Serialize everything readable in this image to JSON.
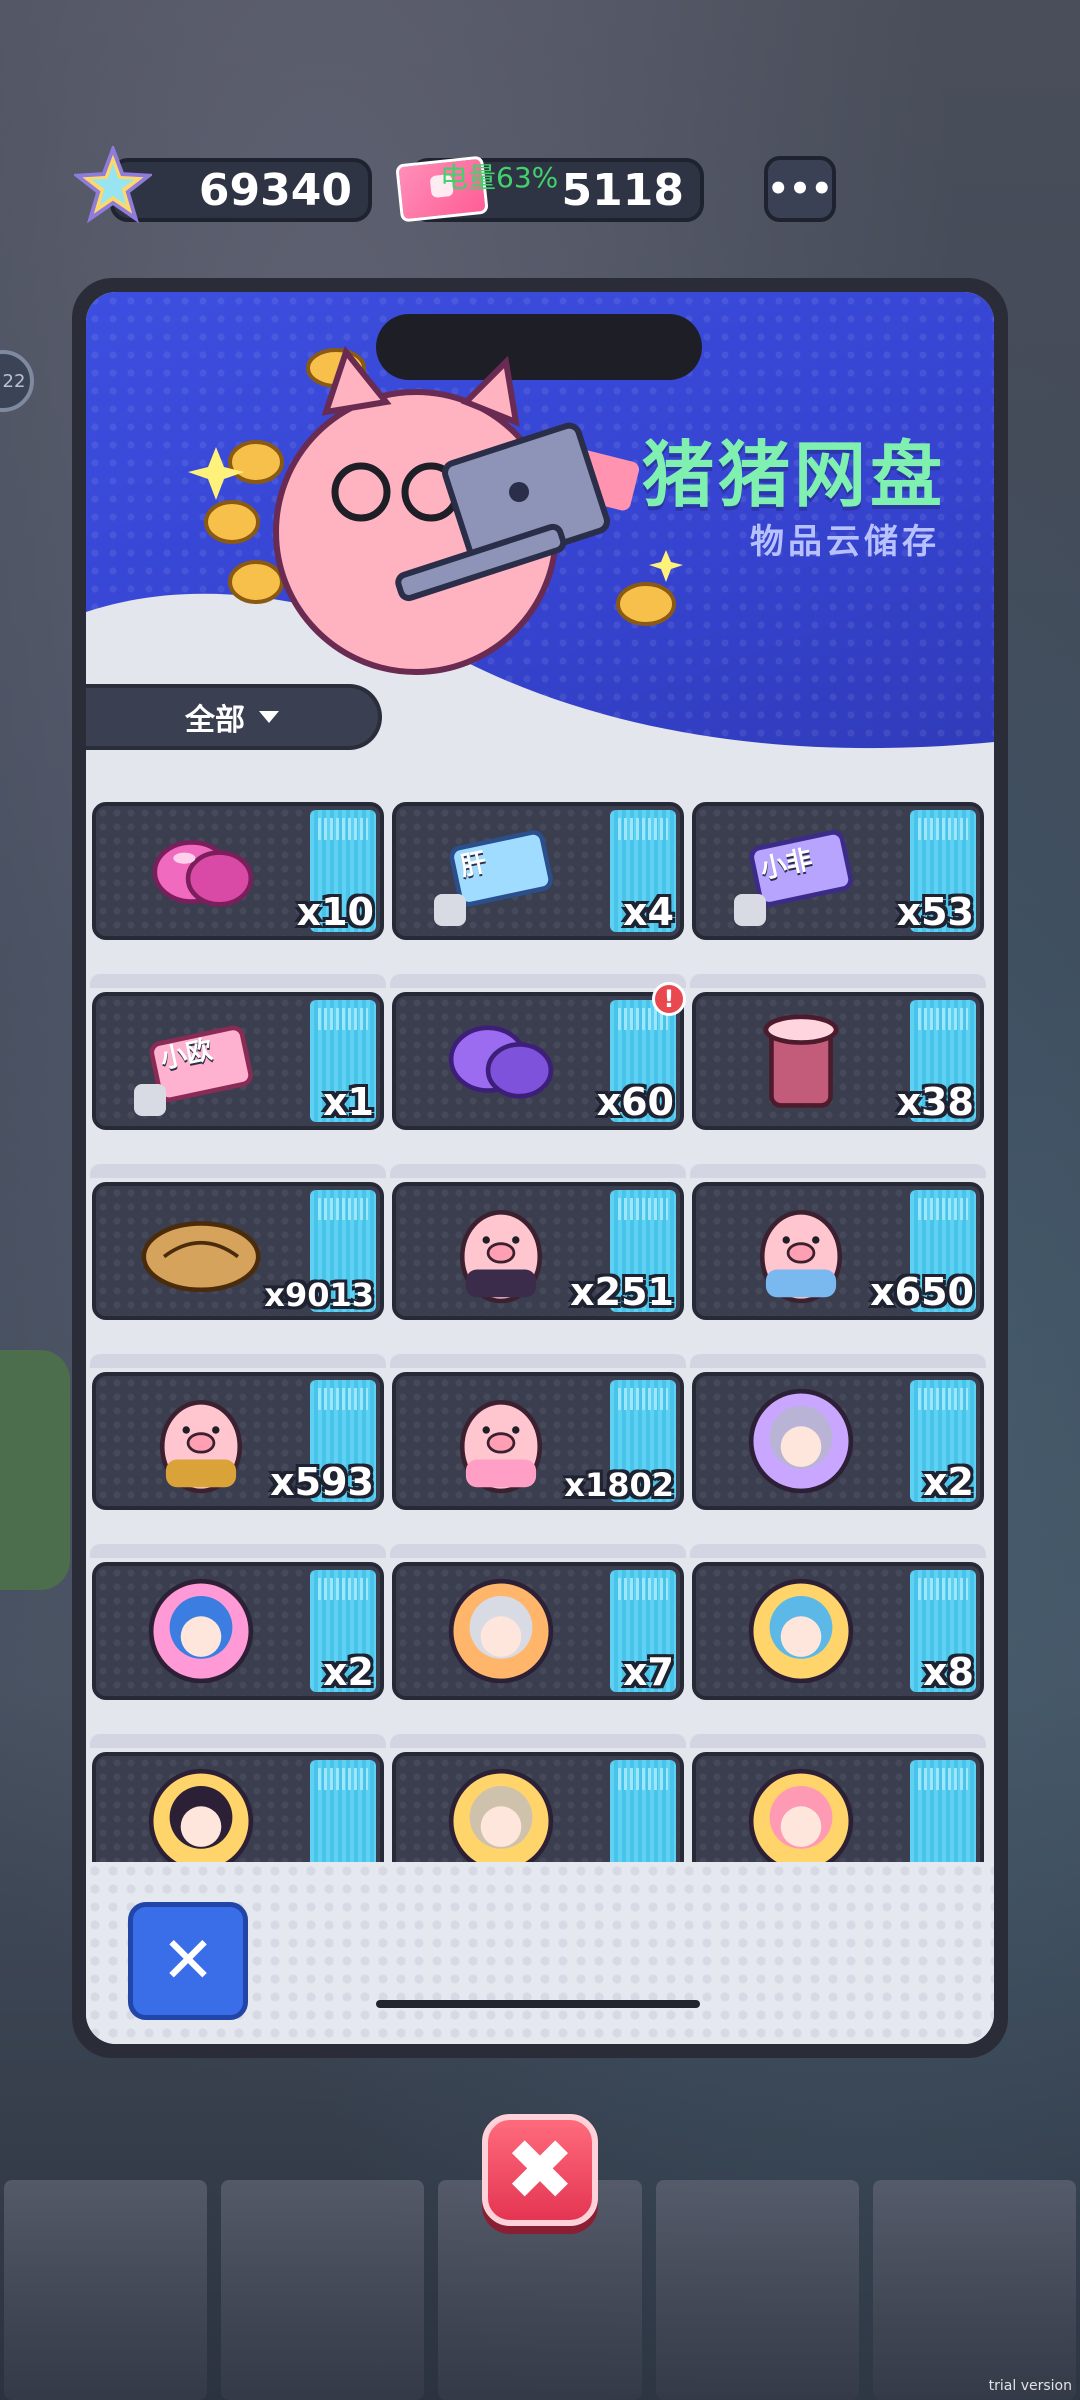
{
  "currency": {
    "stars": "69340",
    "tickets": "5118",
    "more_label": "•••"
  },
  "status": {
    "battery": "电量63%"
  },
  "background": {
    "level_badge": "22"
  },
  "panel": {
    "title": "猪猪网盘",
    "subtitle": "物品云储存",
    "filter_label": "全部"
  },
  "items": [
    {
      "name": "pink-gem",
      "count": "x10"
    },
    {
      "name": "ticket-gan",
      "count": "x4",
      "label": "肝"
    },
    {
      "name": "ticket-xiaofei",
      "count": "x53",
      "label": "小非"
    },
    {
      "name": "ticket-xiaoou",
      "count": "x1",
      "label": "小欧"
    },
    {
      "name": "purple-gem",
      "count": "x60",
      "alert": "!"
    },
    {
      "name": "bubble-tea",
      "count": "x38"
    },
    {
      "name": "croissant",
      "count": "x9013"
    },
    {
      "name": "pig-purple-bow",
      "count": "x251"
    },
    {
      "name": "pig-blue",
      "count": "x650"
    },
    {
      "name": "pig-yellow",
      "count": "x593"
    },
    {
      "name": "pig-pink",
      "count": "x1802"
    },
    {
      "name": "avatar-lilac-hair",
      "count": "x2"
    },
    {
      "name": "avatar-blue-hair",
      "count": "x2"
    },
    {
      "name": "avatar-silver-hair",
      "count": "x7"
    },
    {
      "name": "avatar-teal-hair",
      "count": "x8"
    },
    {
      "name": "avatar-dark-hair",
      "count": ""
    },
    {
      "name": "avatar-beige-hair",
      "count": ""
    },
    {
      "name": "avatar-pink-hair",
      "count": ""
    }
  ],
  "buttons": {
    "close_square": "✕",
    "close_big": "✖"
  },
  "watermark": "trial version"
}
